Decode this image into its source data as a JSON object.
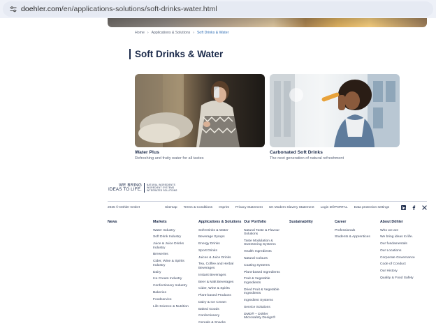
{
  "browser": {
    "url_host": "doehler.com",
    "url_path": "/en/applications-solutions/soft-drinks-water.html"
  },
  "breadcrumb": [
    "Home",
    "Applications & Solutions",
    "Soft Drinks & Water"
  ],
  "page": {
    "title": "Soft Drinks & Water"
  },
  "cards": [
    {
      "title": "Water Plus",
      "description": "Refreshing and fruity water for all tastes"
    },
    {
      "title": "Carbonated Soft Drinks",
      "description": "The next generation of natural refreshment"
    }
  ],
  "logo": {
    "line1": "WE BRING",
    "line2": "IDEAS TO LIFE.",
    "sub": [
      "NATURAL INGREDIENTS",
      "INGREDIENT SYSTEMS",
      "INTEGRATED SOLUTIONS"
    ]
  },
  "footer": {
    "copyright": "2025 © Döhler GmbH",
    "links": [
      "Sitemap",
      "Terms & Conditions",
      "Imprint",
      "Privacy Statement",
      "UK Modern Slavery Statement",
      "Login DÖPORTAL",
      "Data protection settings"
    ],
    "social": [
      "linkedin-icon",
      "facebook-icon",
      "x-icon"
    ],
    "columns": [
      {
        "heading": "News",
        "items": []
      },
      {
        "heading": "Markets",
        "items": [
          "Water Industry",
          "Soft Drink Industry",
          "Juice & Juice Drinks Industry",
          "Breweries",
          "Cider, Wine & Spirits Industry",
          "Dairy",
          "Ice Cream Industry",
          "Confectionery Industry",
          "Bakeries",
          "Foodservice",
          "Life Science & Nutrition"
        ]
      },
      {
        "heading": "Applications & Solutions",
        "items": [
          "Soft Drinks & Water",
          "Beverage Syrups",
          "Energy Drinks",
          "Sport Drinks",
          "Juices & Juice Drinks",
          "Tea, Coffee and Herbal Beverages",
          "Instant Beverages",
          "Beer & Malt Beverages",
          "Cider, Wine & Spirits",
          "Plant-based Products",
          "Dairy & Ice Cream",
          "Baked Goods",
          "Confectionery",
          "Cereals & Snacks"
        ]
      },
      {
        "heading": "Our Portfolio",
        "items": [
          "Natural Taste & Flavour Solutions",
          "Taste Modulation & Sweetening Systems",
          "Health Ingredients",
          "Natural Colours",
          "Coating Systems",
          "Plant-based Ingredients",
          "Fruit & Vegetable Ingredients",
          "Dried Fruit & Vegetable Ingredients",
          "Ingredient Systems",
          "Service Solutions",
          "DMD® – Döhler Microsafety Design®"
        ]
      },
      {
        "heading": "Sustainability",
        "items": []
      },
      {
        "heading": "Career",
        "items": [
          "Professionals",
          "Students & Apprentices"
        ]
      },
      {
        "heading": "About Döhler",
        "items": [
          "Who we are",
          "We bring ideas to life.",
          "Our fundamentals",
          "Our Locations",
          "Corporate Governance",
          "Code of Conduct",
          "Our History",
          "Quality & Food Safety"
        ]
      }
    ]
  }
}
